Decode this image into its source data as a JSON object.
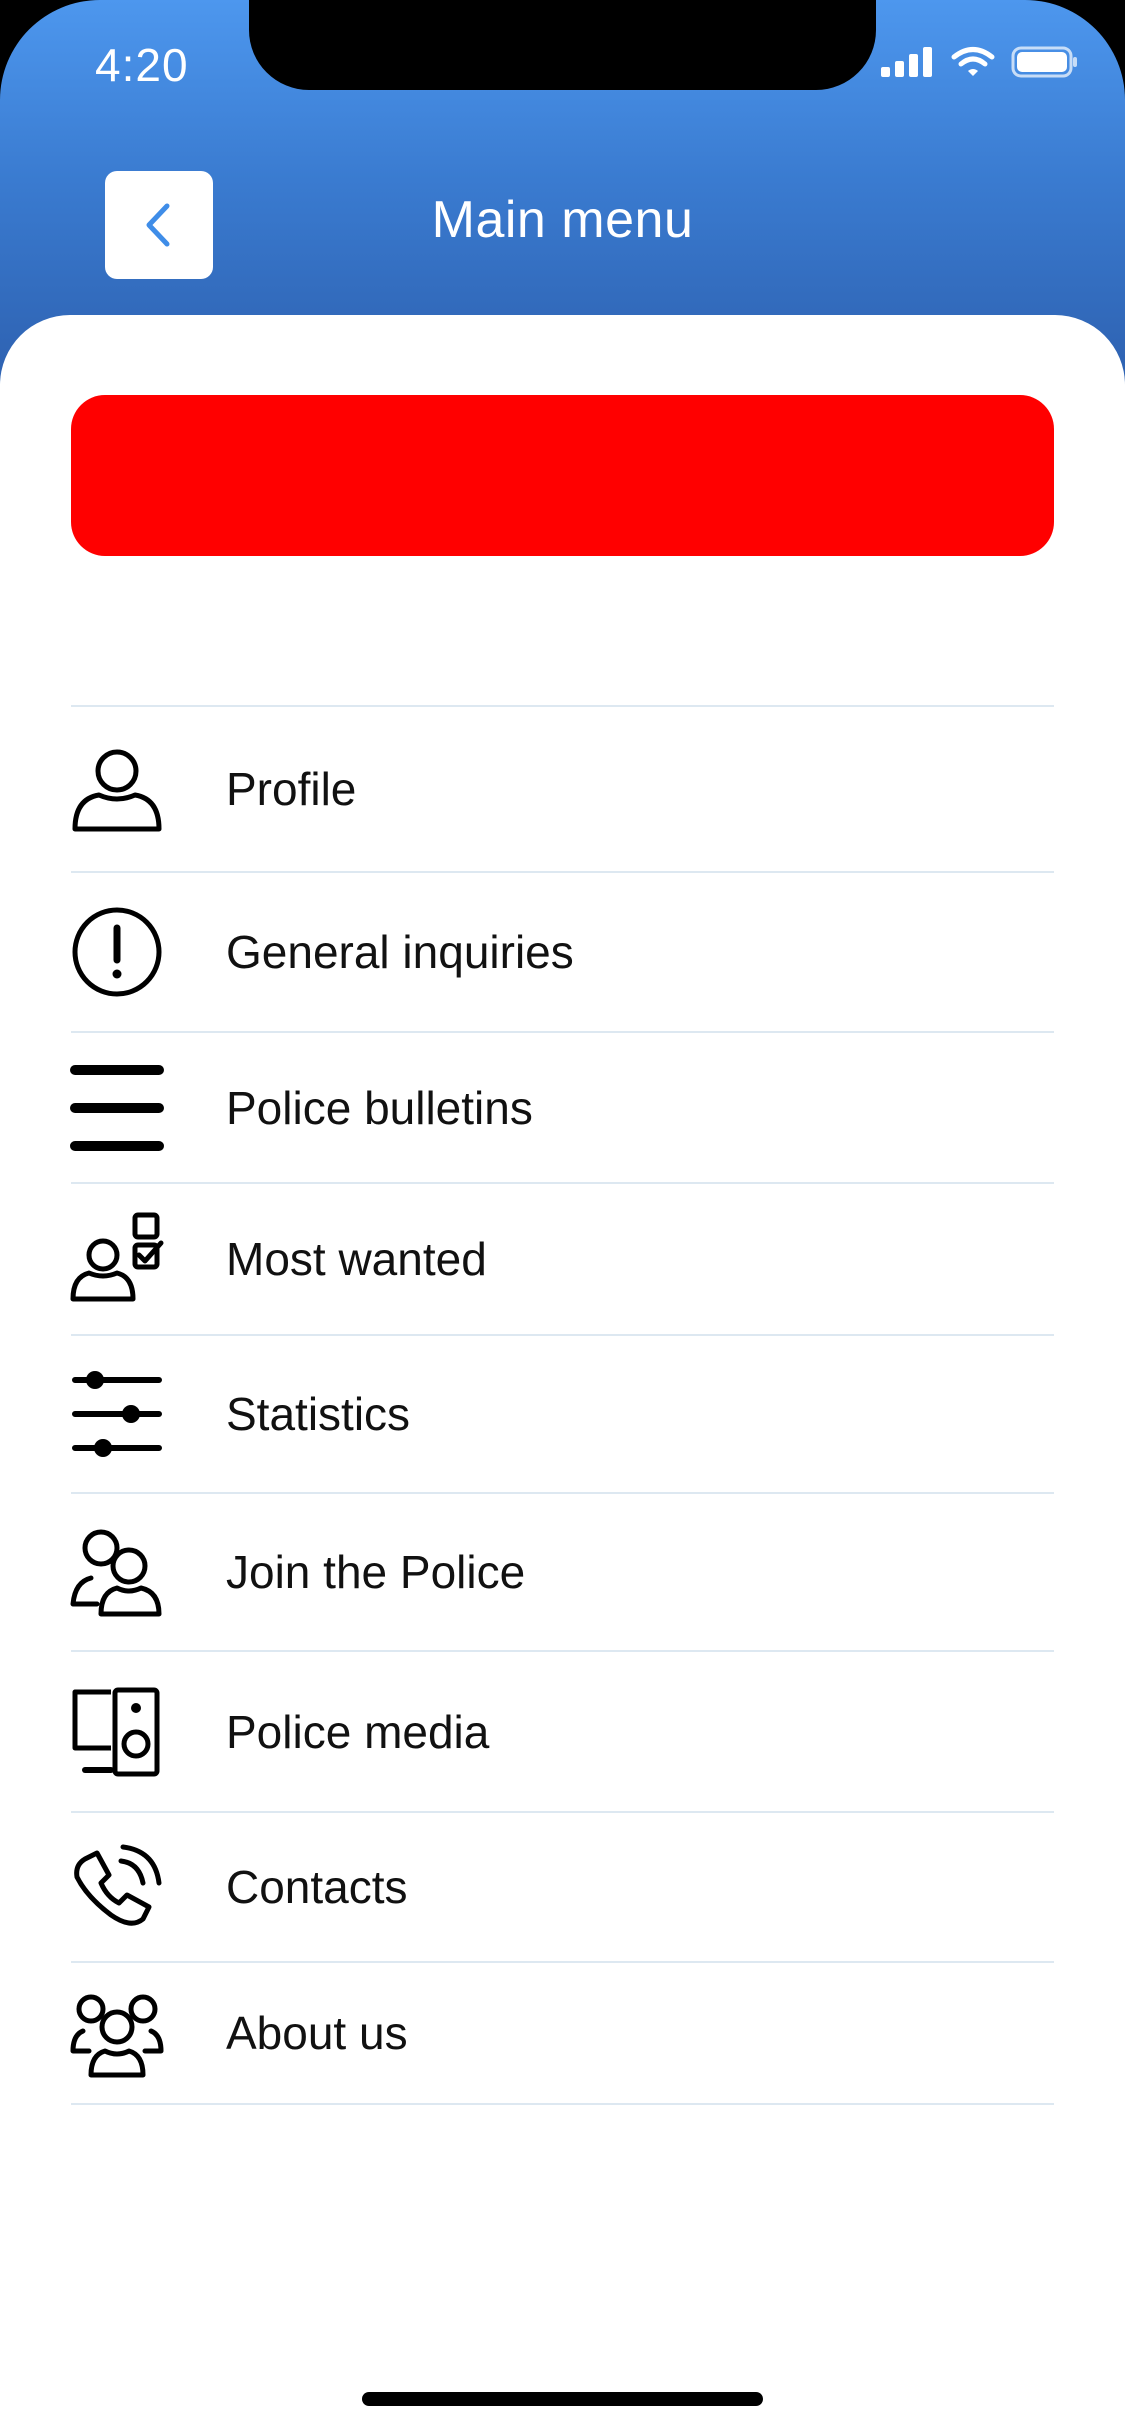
{
  "status_bar": {
    "time": "4:20",
    "icons": [
      "cellular-signal-icon",
      "wifi-icon",
      "battery-icon"
    ]
  },
  "header": {
    "title": "Main menu",
    "back_icon": "chevron-left-icon",
    "color": "#3a7bd0"
  },
  "banner": {
    "color": "#ff0000"
  },
  "menu": {
    "items": [
      {
        "label": "Profile",
        "icon": "person-icon"
      },
      {
        "label": "General inquiries",
        "icon": "exclamation-circle-icon"
      },
      {
        "label": "Police bulletins",
        "icon": "list-lines-icon"
      },
      {
        "label": "Most wanted",
        "icon": "person-checklist-icon"
      },
      {
        "label": "Statistics",
        "icon": "sliders-icon"
      },
      {
        "label": "Join the Police",
        "icon": "two-people-icon"
      },
      {
        "label": "Police media",
        "icon": "monitor-speaker-icon"
      },
      {
        "label": "Contacts",
        "icon": "phone-ringing-icon"
      },
      {
        "label": "About us",
        "icon": "group-icon"
      }
    ]
  }
}
